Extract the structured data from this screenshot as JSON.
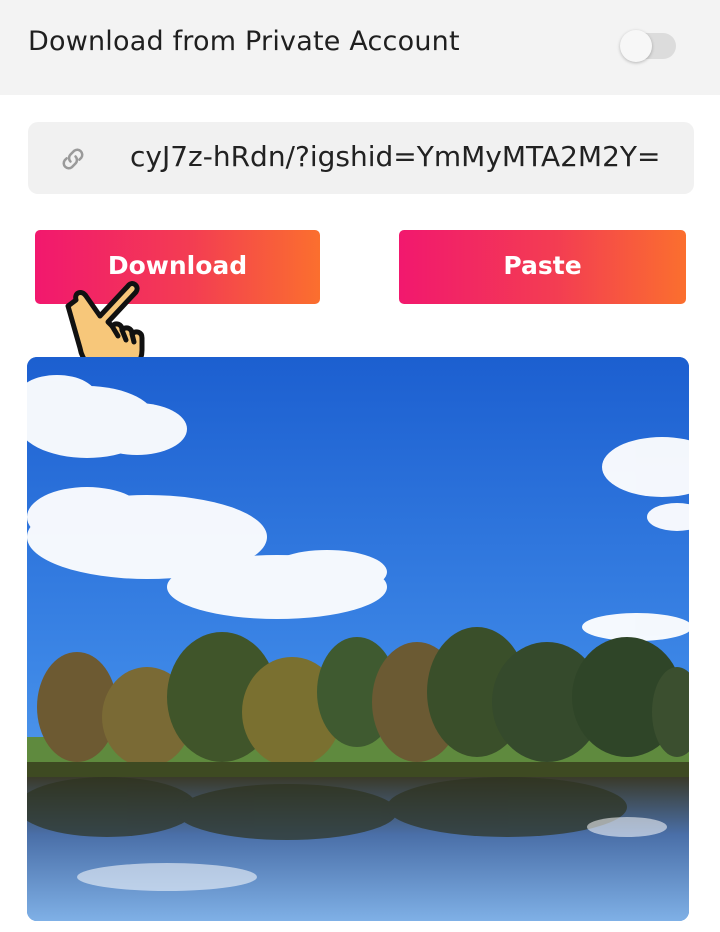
{
  "header": {
    "title": "Download from Private Account",
    "private_toggle_on": false
  },
  "url_input": {
    "value": "cyJ7z-hRdn/?igshid=YmMyMTA2M2Y="
  },
  "buttons": {
    "download_label": "Download",
    "paste_label": "Paste"
  },
  "icons": {
    "link": "link-icon",
    "pointer": "pointing-hand-icon"
  },
  "colors": {
    "gradient_start": "#f2186e",
    "gradient_end": "#fb6f2e",
    "header_bg": "#f3f3f3",
    "field_bg": "#f1f1f1"
  }
}
